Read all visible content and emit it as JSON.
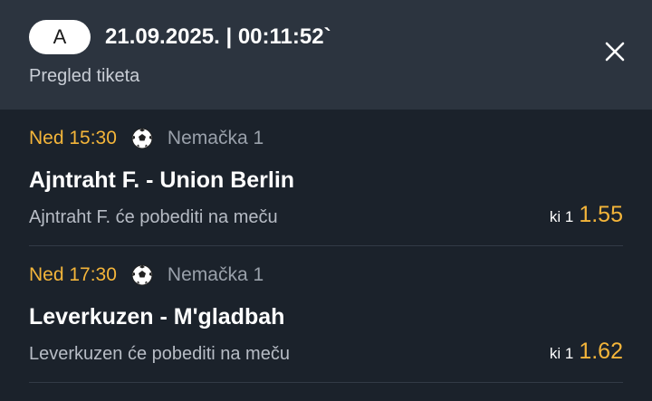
{
  "header": {
    "badge": "A",
    "datetime": "21.09.2025. | 00:11:52`",
    "subtitle": "Pregled tiketa"
  },
  "matches": [
    {
      "time": "Ned 15:30",
      "league": "Nemačka  1",
      "teams": "Ajntraht F. - Union Berlin",
      "pick": "Ajntraht F. će pobediti na meču",
      "odds_label": "ki 1",
      "odds_value": "1.55"
    },
    {
      "time": "Ned 17:30",
      "league": "Nemačka  1",
      "teams": "Leverkuzen - M'gladbah",
      "pick": "Leverkuzen će pobediti na meču",
      "odds_label": "ki 1",
      "odds_value": "1.62"
    }
  ],
  "icons": {
    "sport": "soccer-ball-icon",
    "close": "close-icon"
  },
  "colors": {
    "accent": "#f4b53a",
    "header_bg": "#2c343f",
    "body_bg": "#1b222b"
  }
}
